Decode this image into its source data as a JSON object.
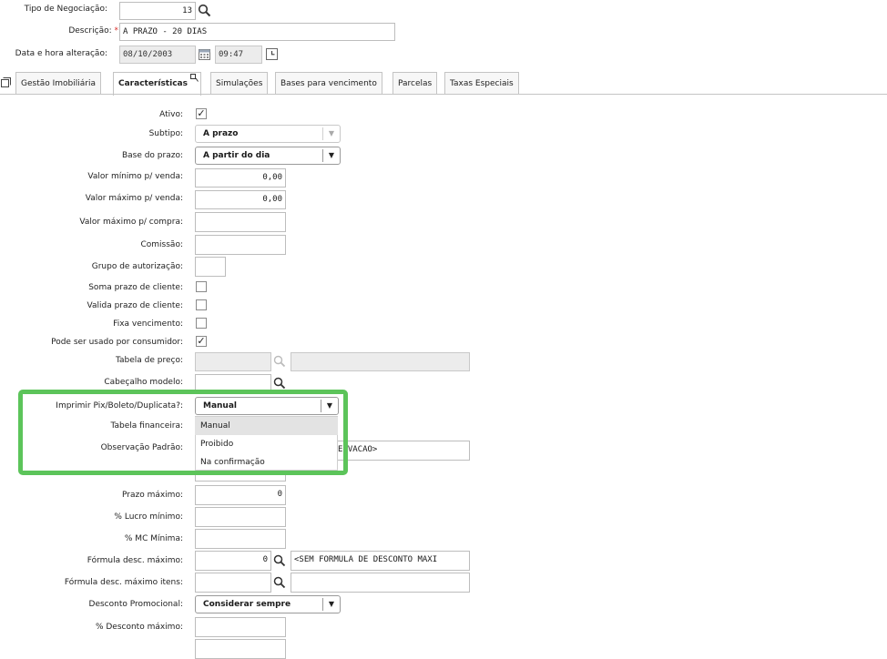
{
  "header": {
    "tipo_label": "Tipo de Negociação:",
    "tipo_value": "13",
    "descricao_label": "Descrição:",
    "required_mark": "*",
    "descricao_value": "A PRAZO - 20 DIAS",
    "data_label": "Data e hora alteração:",
    "date_value": "08/10/2003",
    "time_value": "09:47"
  },
  "tabs": [
    {
      "label": "Gestão Imobiliária"
    },
    {
      "label": "Características"
    },
    {
      "label": "Simulações"
    },
    {
      "label": "Bases para vencimento"
    },
    {
      "label": "Parcelas"
    },
    {
      "label": "Taxas Especiais"
    }
  ],
  "form": {
    "ativo_label": "Ativo:",
    "ativo_checked": "✓",
    "subtipo_label": "Subtipo:",
    "subtipo_value": "A prazo",
    "base_prazo_label": "Base do prazo:",
    "base_prazo_value": "A partir do dia",
    "valor_min_venda_label": "Valor mínimo p/ venda:",
    "valor_min_venda_value": "0,00",
    "valor_max_venda_label": "Valor máximo p/ venda:",
    "valor_max_venda_value": "0,00",
    "valor_max_compra_label": "Valor máximo p/ compra:",
    "comissao_label": "Comissão:",
    "grupo_autorizacao_label": "Grupo de autorização:",
    "soma_prazo_label": "Soma prazo de cliente:",
    "valida_prazo_label": "Valida prazo de cliente:",
    "fixa_vencimento_label": "Fixa vencimento:",
    "pode_consumidor_label": "Pode ser usado por consumidor:",
    "pode_consumidor_checked": "✓",
    "tabela_preco_label": "Tabela de preço:",
    "cabecalho_modelo_label": "Cabeçalho modelo:",
    "imprimir_label": "Imprimir Pix/Boleto/Duplicata?:",
    "imprimir_value": "Manual",
    "imprimir_options": [
      "Manual",
      "Proibido",
      "Na confirmação"
    ],
    "tabela_financeira_label": "Tabela financeira:",
    "observacao_label": "Observação Padrão:",
    "observacao_desc": "ERVACAO>",
    "prazo_maximo_label": "Prazo máximo:",
    "prazo_maximo_value": "0",
    "lucro_minimo_label": "% Lucro mínimo:",
    "mc_minima_label": "% MC Mínima:",
    "formula_desc_max_label": "Fórmula desc. máximo:",
    "formula_desc_max_value": "0",
    "formula_desc_max_desc": "<SEM FORMULA DE DESCONTO MAXI",
    "formula_desc_max_itens_label": "Fórmula desc. máximo itens:",
    "desconto_promocional_label": "Desconto Promocional:",
    "desconto_promocional_value": "Considerar sempre",
    "desconto_maximo_label": "% Desconto máximo:"
  },
  "icons": {
    "search": "magnifier-icon",
    "calendar": "calendar-icon",
    "clock": "clock-icon",
    "window": "window-icon",
    "tab_menu": "tab-menu-icon"
  },
  "colors": {
    "highlight": "#5cc45a",
    "required": "#d9302b",
    "dropdown_selected": "#e3e3e3"
  }
}
